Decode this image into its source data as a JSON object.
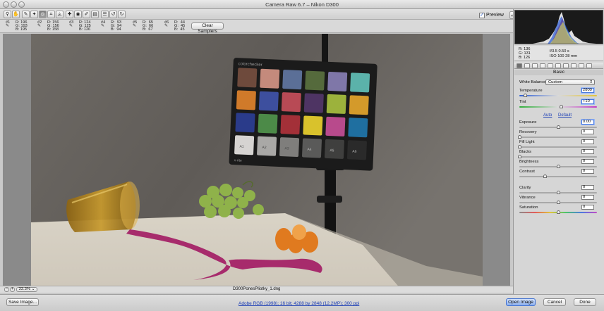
{
  "window": {
    "title": "Camera Raw 6.7  –  Nikon D300"
  },
  "toolbar": {
    "tools": [
      {
        "name": "zoom-tool",
        "glyph": "⚲"
      },
      {
        "name": "hand-tool",
        "glyph": "✋"
      },
      {
        "name": "white-balance-tool",
        "glyph": "✎"
      },
      {
        "name": "color-sampler-tool",
        "glyph": "✦"
      },
      {
        "name": "targeted-adjustment-tool",
        "glyph": "◎"
      },
      {
        "name": "crop-tool",
        "glyph": "⌗"
      },
      {
        "name": "straighten-tool",
        "glyph": "◬"
      },
      {
        "name": "spot-removal-tool",
        "glyph": "✚"
      },
      {
        "name": "red-eye-tool",
        "glyph": "◉"
      },
      {
        "name": "adjustment-brush-tool",
        "glyph": "✐"
      },
      {
        "name": "graduated-filter-tool",
        "glyph": "▤"
      },
      {
        "name": "preferences-tool",
        "glyph": "☰"
      },
      {
        "name": "rotate-ccw-tool",
        "glyph": "↺"
      },
      {
        "name": "rotate-cw-tool",
        "glyph": "↻"
      }
    ],
    "preview_label": "Preview",
    "preview_checked": "✓",
    "fullscreen_glyph": "⤢"
  },
  "samplers": [
    {
      "num": "#1",
      "r": "R: 196",
      "g": "G: 193",
      "b": "B: 195"
    },
    {
      "num": "#2",
      "r": "R: 156",
      "g": "G: 156",
      "b": "B: 158"
    },
    {
      "num": "#3",
      "r": "R: 124",
      "g": "G: 125",
      "b": "B: 126"
    },
    {
      "num": "#4",
      "r": "R:  93",
      "g": "G:  94",
      "b": "B:  94"
    },
    {
      "num": "#5",
      "r": "R:  65",
      "g": "G:  66",
      "b": "B:  67"
    },
    {
      "num": "#6",
      "r": "R:  44",
      "g": "G:  45",
      "b": "B:  45"
    }
  ],
  "clear_samplers_label": "Clear Samplers",
  "status": {
    "zoom": "33.3%",
    "filename": "D300PonesPliotky_1.dng"
  },
  "bottom": {
    "save_label": "Save Image...",
    "workflow_link": "Adobe RGB (1998); 16 bit; 4288 by 2848 (12.2MP); 300 ppi",
    "open_label": "Open Image",
    "cancel_label": "Cancel",
    "done_label": "Done"
  },
  "info": {
    "r": "R:  136",
    "g": "G:  131",
    "b": "B:  126",
    "aperture_shutter": "f/3.5   0.50 s",
    "iso_focal": "ISO 100   28 mm"
  },
  "panel": {
    "title": "Basic",
    "white_balance_label": "White Balance:",
    "white_balance_value": "Custom",
    "auto_label": "Auto",
    "default_label": "Default",
    "controls": [
      {
        "key": "temperature",
        "label": "Temperature",
        "value": "2800",
        "level": 0.07,
        "track": "temp"
      },
      {
        "key": "tint",
        "label": "Tint",
        "value": "+10",
        "level": 0.54,
        "track": "tint"
      },
      {
        "key": "exposure",
        "label": "Exposure",
        "value": "0.00",
        "level": 0.5,
        "track": "gray"
      },
      {
        "key": "recovery",
        "label": "Recovery",
        "value": "0",
        "level": 0.0,
        "track": "gray"
      },
      {
        "key": "fill-light",
        "label": "Fill Light",
        "value": "0",
        "level": 0.0,
        "track": "gray"
      },
      {
        "key": "blacks",
        "label": "Blacks",
        "value": "0",
        "level": 0.0,
        "track": "gray"
      },
      {
        "key": "brightness",
        "label": "Brightness",
        "value": "0",
        "level": 0.5,
        "track": "gray"
      },
      {
        "key": "contrast",
        "label": "Contrast",
        "value": "0",
        "level": 0.33,
        "track": "gray"
      },
      {
        "key": "clarity",
        "label": "Clarity",
        "value": "0",
        "level": 0.5,
        "track": "gray"
      },
      {
        "key": "vibrance",
        "label": "Vibrance",
        "value": "0",
        "level": 0.5,
        "track": "gray"
      },
      {
        "key": "saturation",
        "label": "Saturation",
        "value": "0",
        "level": 0.5,
        "track": "sat"
      }
    ]
  },
  "checker": {
    "brand": "colorchecker",
    "patches": [
      "#6e4a3c",
      "#c48a7c",
      "#5b6f97",
      "#556a3c",
      "#7f77a8",
      "#5bb2aa",
      "#d07a2a",
      "#3d4f9e",
      "#b84a55",
      "#4e3463",
      "#9cb23c",
      "#d49a2a",
      "#2a3b8a",
      "#4c8a48",
      "#a33038",
      "#d9c22c",
      "#b84a8c",
      "#1f6fa0"
    ],
    "grays": [
      "#d6d4d2",
      "#a9a8a6",
      "#7f7e7c",
      "#5a5a59",
      "#3f3f3e",
      "#2a2a2a"
    ],
    "gray_labels": [
      "A1",
      "A2",
      "A3",
      "A4",
      "A5",
      "A6"
    ],
    "footer": "x-rite"
  },
  "colors": {
    "accent": "#1d3fb5",
    "spill": "#a21a63",
    "grape": "#8fb24a",
    "orange": "#e07a1f"
  }
}
